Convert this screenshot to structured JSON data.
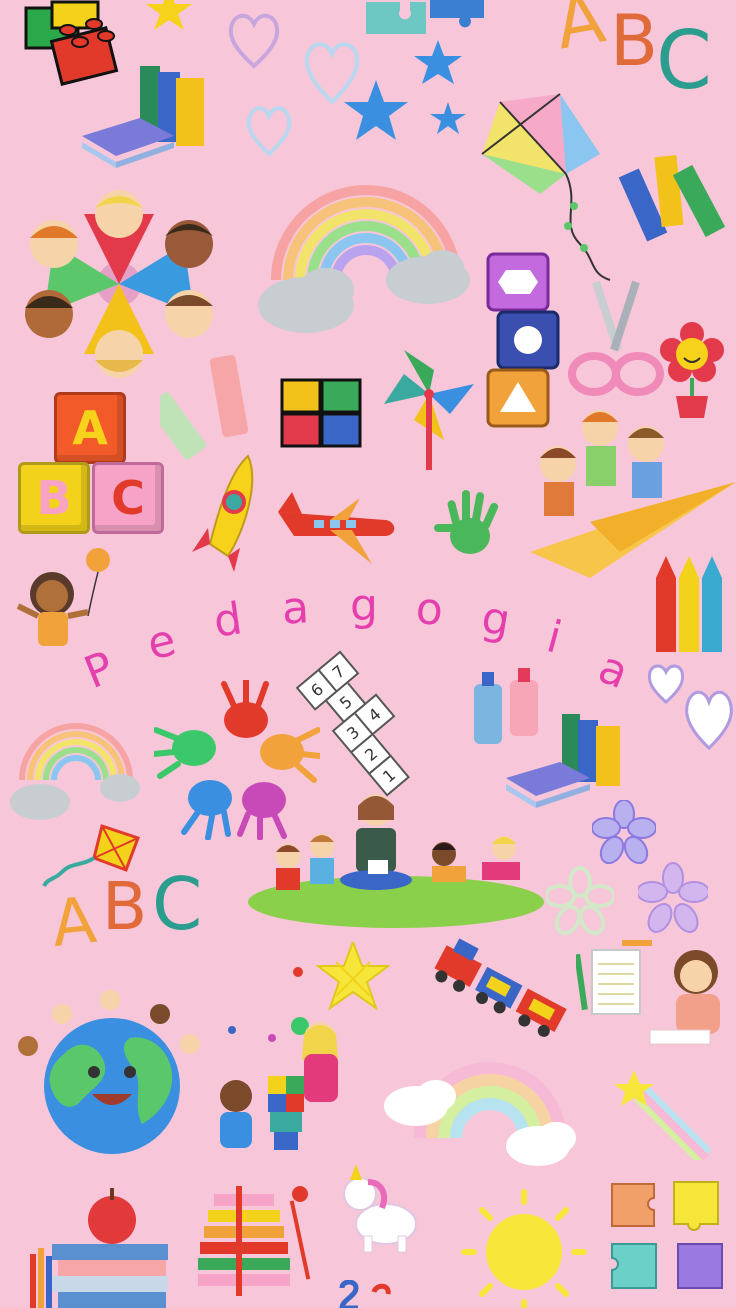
{
  "title": {
    "letters": [
      "P",
      "e",
      "d",
      "a",
      "g",
      "o",
      "g",
      "i",
      "a"
    ]
  },
  "blocks": {
    "a": "A",
    "b": "B",
    "c": "C"
  },
  "abc_top": [
    "A",
    "B",
    "C"
  ],
  "abc_left": [
    "A",
    "B",
    "C"
  ],
  "hopscotch": [
    "1",
    "2",
    "3",
    "4",
    "5",
    "6",
    "7"
  ],
  "shape_blocks": [
    "hexagon",
    "circle",
    "triangle"
  ],
  "colors": {
    "background": "#f7c6d9",
    "title": "#e53fae"
  }
}
